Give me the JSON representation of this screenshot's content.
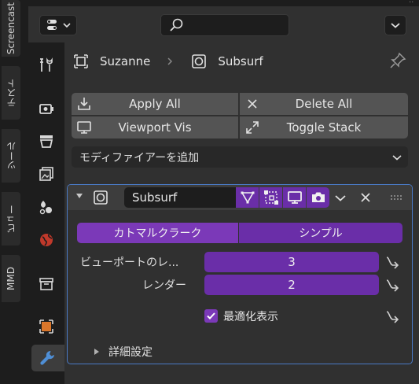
{
  "side_tabs": [
    "Screencast",
    "テスト",
    "ツール",
    "ビュー",
    "MMD"
  ],
  "header": {
    "editor_type_icon": "properties-editor-icon",
    "search": {
      "placeholder": "",
      "icon": "search-icon"
    }
  },
  "breadcrumb": {
    "object": "Suzanne",
    "modifier": "Subsurf"
  },
  "actions": {
    "apply_all": "Apply All",
    "delete_all": "Delete All",
    "viewport_vis": "Viewport Vis",
    "toggle_stack": "Toggle Stack"
  },
  "add_modifier": "モディファイアーを追加",
  "modifier": {
    "name": "Subsurf",
    "method_options": [
      "カトマルクラーク",
      "シンプル"
    ],
    "selected_method": "カトマルクラーク",
    "levels_viewport_label": "ビューポートのレ...",
    "levels_viewport": "3",
    "render_label": "レンダー",
    "render": "2",
    "optimal_display_label": "最適化表示",
    "optimal_display": true,
    "advanced_label": "詳細設定"
  },
  "colors": {
    "accent_purple": "#6a2ea8",
    "highlight_purple": "#7b39b8",
    "active_border": "#4a7ac6",
    "panel_bg": "#303030"
  }
}
